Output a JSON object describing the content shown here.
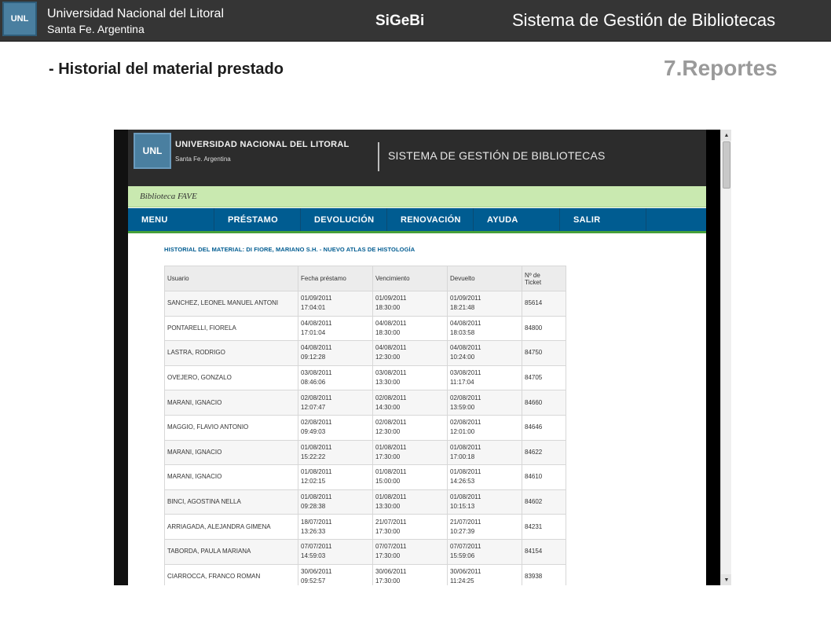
{
  "slide": {
    "logo": "UNL",
    "university": "Universidad Nacional del Litoral",
    "city": "Santa Fe. Argentina",
    "brand": "SiGeBi",
    "system_title": "Sistema de Gestión de Bibliotecas",
    "subtitle": "- Historial del material prestado",
    "section": "7.Reportes"
  },
  "app": {
    "logo": "UNL",
    "university": "UNIVERSIDAD NACIONAL DEL LITORAL",
    "city": "Santa Fe. Argentina",
    "system_title": "SISTEMA DE GESTIÓN DE BIBLIOTECAS",
    "library": "Biblioteca FAVE",
    "menu": [
      "MENU",
      "PRÉSTAMO",
      "DEVOLUCIÓN",
      "RENOVACIÓN",
      "AYUDA",
      "SALIR"
    ],
    "history_title": "HISTORIAL DEL MATERIAL: DI FIORE, MARIANO S.H. - NUEVO ATLAS DE HISTOLOGÍA",
    "columns": [
      "Usuario",
      "Fecha préstamo",
      "Vencimiento",
      "Devuelto",
      "Nº de Ticket"
    ],
    "rows": [
      {
        "usuario": "SANCHEZ, LEONEL MANUEL ANTONI",
        "prestamo_fecha": "01/09/2011",
        "prestamo_hora": "17:04:01",
        "venc_fecha": "01/09/2011",
        "venc_hora": "18:30:00",
        "dev_fecha": "01/09/2011",
        "dev_hora": "18:21:48",
        "ticket": "85614"
      },
      {
        "usuario": "PONTARELLI, FIORELA",
        "prestamo_fecha": "04/08/2011",
        "prestamo_hora": "17:01:04",
        "venc_fecha": "04/08/2011",
        "venc_hora": "18:30:00",
        "dev_fecha": "04/08/2011",
        "dev_hora": "18:03:58",
        "ticket": "84800"
      },
      {
        "usuario": "LASTRA, RODRIGO",
        "prestamo_fecha": "04/08/2011",
        "prestamo_hora": "09:12:28",
        "venc_fecha": "04/08/2011",
        "venc_hora": "12:30:00",
        "dev_fecha": "04/08/2011",
        "dev_hora": "10:24:00",
        "ticket": "84750"
      },
      {
        "usuario": "OVEJERO, GONZALO",
        "prestamo_fecha": "03/08/2011",
        "prestamo_hora": "08:46:06",
        "venc_fecha": "03/08/2011",
        "venc_hora": "13:30:00",
        "dev_fecha": "03/08/2011",
        "dev_hora": "11:17:04",
        "ticket": "84705"
      },
      {
        "usuario": "MARANI, IGNACIO",
        "prestamo_fecha": "02/08/2011",
        "prestamo_hora": "12:07:47",
        "venc_fecha": "02/08/2011",
        "venc_hora": "14:30:00",
        "dev_fecha": "02/08/2011",
        "dev_hora": "13:59:00",
        "ticket": "84660"
      },
      {
        "usuario": "MAGGIO, FLAVIO ANTONIO",
        "prestamo_fecha": "02/08/2011",
        "prestamo_hora": "09:49:03",
        "venc_fecha": "02/08/2011",
        "venc_hora": "12:30:00",
        "dev_fecha": "02/08/2011",
        "dev_hora": "12:01:00",
        "ticket": "84646"
      },
      {
        "usuario": "MARANI, IGNACIO",
        "prestamo_fecha": "01/08/2011",
        "prestamo_hora": "15:22:22",
        "venc_fecha": "01/08/2011",
        "venc_hora": "17:30:00",
        "dev_fecha": "01/08/2011",
        "dev_hora": "17:00:18",
        "ticket": "84622"
      },
      {
        "usuario": "MARANI, IGNACIO",
        "prestamo_fecha": "01/08/2011",
        "prestamo_hora": "12:02:15",
        "venc_fecha": "01/08/2011",
        "venc_hora": "15:00:00",
        "dev_fecha": "01/08/2011",
        "dev_hora": "14:26:53",
        "ticket": "84610"
      },
      {
        "usuario": "BINCI, AGOSTINA NELLA",
        "prestamo_fecha": "01/08/2011",
        "prestamo_hora": "09:28:38",
        "venc_fecha": "01/08/2011",
        "venc_hora": "13:30:00",
        "dev_fecha": "01/08/2011",
        "dev_hora": "10:15:13",
        "ticket": "84602"
      },
      {
        "usuario": "ARRIAGADA, ALEJANDRA GIMENA",
        "prestamo_fecha": "18/07/2011",
        "prestamo_hora": "13:26:33",
        "venc_fecha": "21/07/2011",
        "venc_hora": "17:30:00",
        "dev_fecha": "21/07/2011",
        "dev_hora": "10:27:39",
        "ticket": "84231"
      },
      {
        "usuario": "TABORDA, PAULA MARIANA",
        "prestamo_fecha": "07/07/2011",
        "prestamo_hora": "14:59:03",
        "venc_fecha": "07/07/2011",
        "venc_hora": "17:30:00",
        "dev_fecha": "07/07/2011",
        "dev_hora": "15:59:06",
        "ticket": "84154"
      },
      {
        "usuario": "CIARROCCA, FRANCO ROMAN",
        "prestamo_fecha": "30/06/2011",
        "prestamo_hora": "09:52:57",
        "venc_fecha": "30/06/2011",
        "venc_hora": "17:30:00",
        "dev_fecha": "30/06/2011",
        "dev_hora": "11:24:25",
        "ticket": "83938"
      }
    ]
  },
  "colors": {
    "slide_header": "#353535",
    "app_header": "#2c2c2c",
    "library_bar": "#c9e9b0",
    "menu_bar": "#005c91",
    "menu_underline": "#46a03a",
    "title_blue": "#005c91",
    "section_gray": "#9a9a9a"
  },
  "icons": {
    "scroll_up": "▲",
    "scroll_down": "▼"
  }
}
